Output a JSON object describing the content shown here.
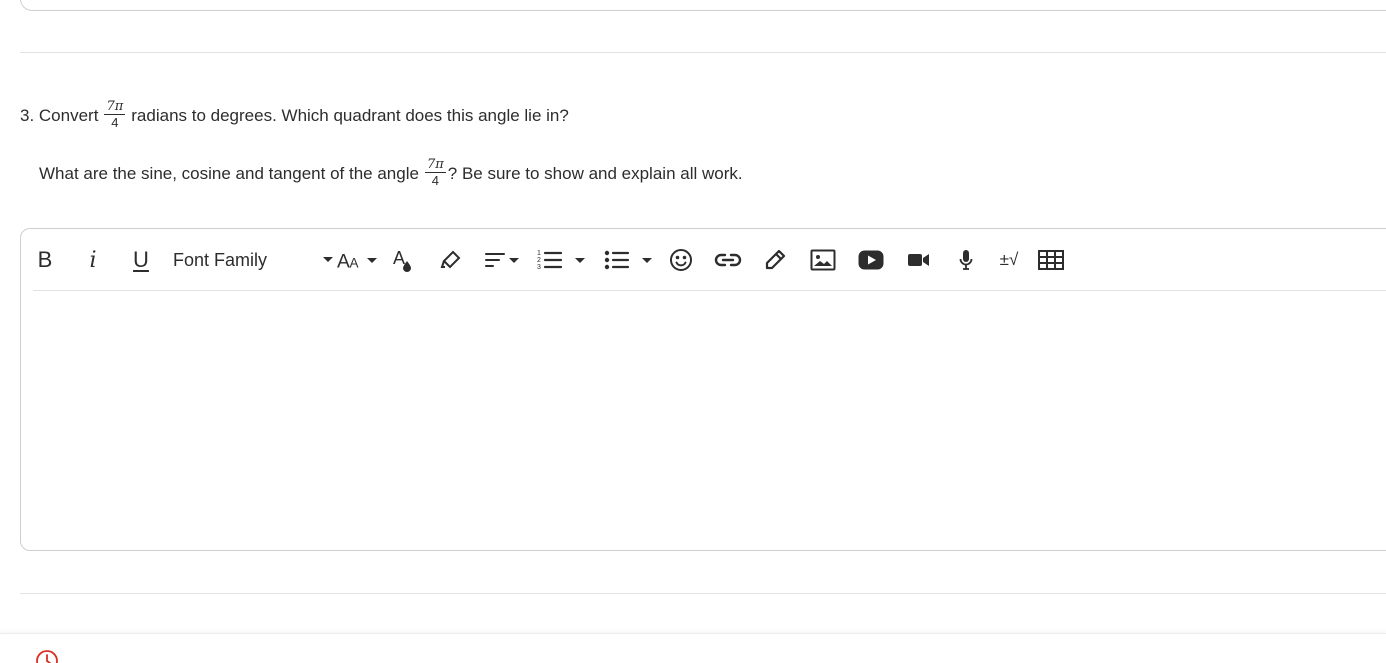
{
  "question": {
    "line1_prefix": "3. Convert",
    "line1_suffix": "radians to degrees.  Which quadrant does this angle lie in?",
    "line2_prefix": "What are the sine, cosine and tangent of the angle",
    "line2_suffix": "?  Be sure to show and explain all work.",
    "fraction_numerator": "7π",
    "fraction_denominator": "4"
  },
  "toolbar": {
    "bold_label": "B",
    "italic_label": "i",
    "underline_label": "U",
    "font_family_label": "Font Family",
    "math_label": "±√",
    "icons": [
      "bold-icon",
      "italic-icon",
      "underline-icon",
      "font-size-icon",
      "text-color-icon",
      "highlight-icon",
      "align-icon",
      "numbered-list-icon",
      "bullet-list-icon",
      "emoji-icon",
      "link-icon",
      "pencil-icon",
      "image-icon",
      "youtube-icon",
      "video-icon",
      "microphone-icon",
      "math-icon",
      "table-icon"
    ]
  },
  "colors": {
    "accent_red": "#d93025",
    "border": "#cfcfcf",
    "text": "#2d2d2d"
  }
}
